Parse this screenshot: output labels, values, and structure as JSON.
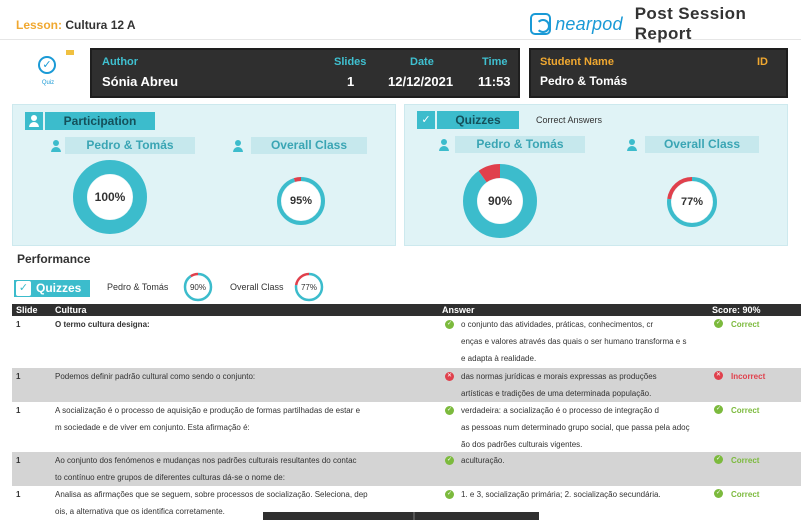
{
  "header": {
    "lesson_label": "Lesson:",
    "lesson_name": "Cultura 12 A",
    "brand_name": "nearpod",
    "report_title": "Post Session Report"
  },
  "quiz_icon": {
    "icon": "check-circle-icon",
    "label": "Quiz"
  },
  "author_box": {
    "author_label": "Author",
    "author_value": "Sónia  Abreu",
    "slides_label": "Slides",
    "slides_value": "1",
    "date_label": "Date",
    "date_value": "12/12/2021",
    "time_label": "Time",
    "time_value": "11:53"
  },
  "student_box": {
    "name_label": "Student Name",
    "name_value": "Pedro & Tomás",
    "id_label": "ID",
    "id_value": ""
  },
  "participation": {
    "title": "Participation",
    "student_label": "Pedro & Tomás",
    "class_label": "Overall Class",
    "student_pct": 100,
    "student_text": "100%",
    "class_pct": 95,
    "class_text": "95%"
  },
  "quizzes": {
    "title": "Quizzes",
    "hint": "Correct Answers",
    "student_label": "Pedro & Tomás",
    "class_label": "Overall Class",
    "student_pct": 90,
    "student_text": "90%",
    "class_pct": 77,
    "class_text": "77%"
  },
  "performance": {
    "title": "Performance",
    "quizzes_label": "Quizzes",
    "student_label": "Pedro & Tomás",
    "student_text": "90%",
    "student_pct": 90,
    "class_label": "Overall Class",
    "class_text": "77%",
    "class_pct": 77
  },
  "colors": {
    "teal": "#3cbccc",
    "incorrect": "#e0404c",
    "correct": "#7cba3d",
    "accent": "#f0a830"
  },
  "table": {
    "headers": {
      "slide": "Slide",
      "question": "Cultura",
      "answer": "Answer",
      "score": "Score: 90%"
    },
    "rows": [
      {
        "slide": "1",
        "question": [
          "O termo cultura designa:"
        ],
        "answer": [
          "o conjunto das atividades, práticas, conhecimentos, cr",
          "enças e valores através das quais o ser humano transforma e s",
          "e adapta à realidade."
        ],
        "correct": true,
        "score": "Correct"
      },
      {
        "slide": "1",
        "question": [
          "Podemos definir padrão cultural como sendo o conjunto:"
        ],
        "answer": [
          "das normas jurídicas e morais expressas as produções",
          "artísticas e tradições de uma determinada população."
        ],
        "correct": false,
        "score": "Incorrect"
      },
      {
        "slide": "1",
        "question": [
          "A socialização é o processo de aquisição e produção de formas partilhadas de estar e",
          "m sociedade e de viver em conjunto. Esta afirmação é:"
        ],
        "answer": [
          "verdadeira: a socialização é o processo de integração d",
          "as pessoas num determinado grupo social, que passa pela adoç",
          "ão dos padrões culturais vigentes."
        ],
        "correct": true,
        "score": "Correct"
      },
      {
        "slide": "1",
        "question": [
          "Ao conjunto dos fenómenos e mudanças nos padrões culturais resultantes do contac",
          "to contínuo entre grupos de diferentes culturas dá-se o nome de:"
        ],
        "answer": [
          "aculturação."
        ],
        "correct": true,
        "score": "Correct"
      },
      {
        "slide": "1",
        "question": [
          "Analisa as afirmações que se seguem, sobre processos de socialização. Seleciona, dep",
          "ois, a alternativa que os identifica corretamente."
        ],
        "answer": [
          "1. e 3, socialização primária; 2. socialização secundária."
        ],
        "correct": true,
        "score": "Correct"
      }
    ]
  }
}
